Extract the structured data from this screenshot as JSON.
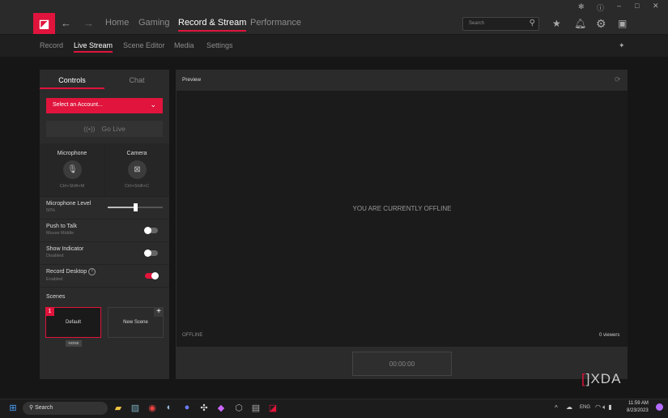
{
  "window": {
    "controls": [
      "bug-icon",
      "help-icon",
      "minimize-icon",
      "maximize-icon",
      "close-icon"
    ]
  },
  "topnav": {
    "logo": "AMD",
    "items": [
      "Home",
      "Gaming",
      "Record & Stream",
      "Performance"
    ],
    "active": "Record & Stream",
    "search_placeholder": "Search"
  },
  "subnav": {
    "items": [
      "Record",
      "Live Stream",
      "Scene Editor",
      "Media",
      "Settings"
    ],
    "active": "Live Stream"
  },
  "controls": {
    "tabs": [
      "Controls",
      "Chat"
    ],
    "account_select": "Select an Account...",
    "go_live": "Go Live",
    "microphone": {
      "label": "Microphone",
      "shortcut": "Ctrl+Shift+M"
    },
    "camera": {
      "label": "Camera",
      "shortcut": "Ctrl+Shift+C"
    },
    "mic_level": {
      "label": "Microphone Level",
      "value_text": "50%",
      "value": 50
    },
    "push_to_talk": {
      "label": "Push to Talk",
      "sub": "Mouse Middle",
      "on": false
    },
    "show_indicator": {
      "label": "Show Indicator",
      "sub": "Disabled",
      "on": false
    },
    "record_desktop": {
      "label": "Record Desktop",
      "sub": "Enabled",
      "on": true
    },
    "scenes": {
      "label": "Scenes",
      "items": [
        {
          "num": "1",
          "name": "Default",
          "badge": "NONE"
        },
        {
          "name": "New Scene"
        }
      ]
    }
  },
  "preview": {
    "title": "Preview",
    "message": "YOU ARE CURRENTLY OFFLINE",
    "status": "OFFLINE",
    "viewers": "0 viewers",
    "timer": "00:00:00"
  },
  "watermark": "XDA",
  "taskbar": {
    "search": "Search",
    "lang": "ENG",
    "time": "11:59 AM",
    "date": "8/23/2023"
  },
  "colors": {
    "accent": "#e0143c"
  }
}
